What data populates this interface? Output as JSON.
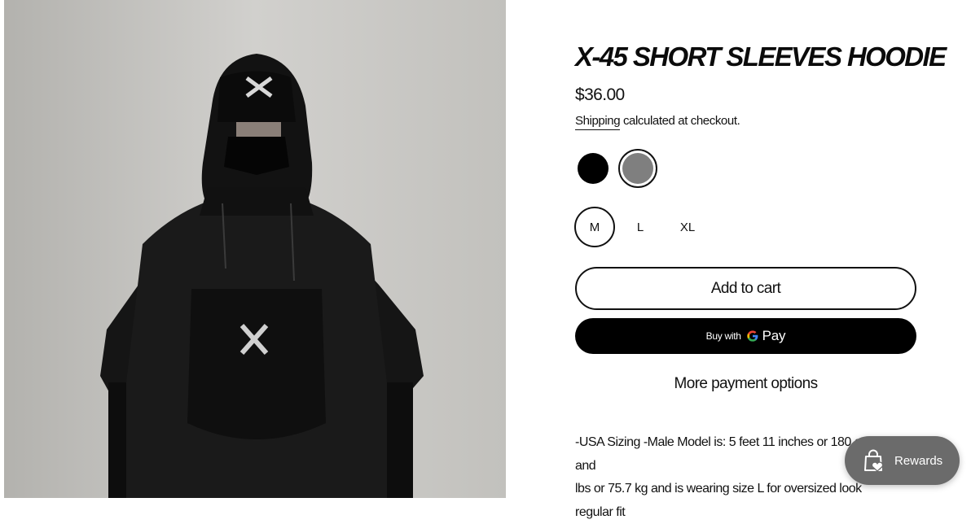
{
  "product": {
    "title": "X-45 SHORT SLEEVES HOODIE",
    "price": "$36.00",
    "shipping_link": "Shipping",
    "shipping_rest": " calculated at checkout.",
    "colors": [
      {
        "name": "black",
        "hex": "#000000",
        "selected": false
      },
      {
        "name": "grey",
        "hex": "#7f7f7f",
        "selected": true
      }
    ],
    "sizes": [
      "M",
      "L",
      "XL"
    ],
    "selected_size": "M",
    "image_icon": "product-photo-black-hoodie"
  },
  "buttons": {
    "add_to_cart": "Add to cart",
    "buy_with": "Buy with",
    "gpay": "Pay",
    "more_payment": "More payment options"
  },
  "description": {
    "line1": "-USA Sizing -Male Model is: 5 feet 11 inches or 180 cm and",
    "line2": "lbs or 75.7 kg and is wearing size L for oversized look",
    "line3": "regular fit"
  },
  "rewards": {
    "label": "Rewards",
    "icon": "shopping-bag-heart-icon"
  },
  "colors": {
    "background": "#ffffff",
    "text": "#111111",
    "gpay_bg": "#000000",
    "rewards_bg": "#6b6b6b"
  }
}
